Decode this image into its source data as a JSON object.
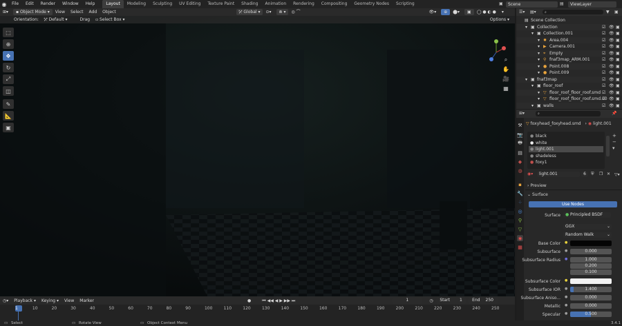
{
  "topbar": {
    "menus": [
      "File",
      "Edit",
      "Render",
      "Window",
      "Help"
    ],
    "workspaces": [
      "Layout",
      "Modeling",
      "Sculpting",
      "UV Editing",
      "Texture Paint",
      "Shading",
      "Animation",
      "Rendering",
      "Compositing",
      "Geometry Nodes",
      "Scripting"
    ],
    "active_workspace": "Layout",
    "scene": "Scene",
    "view_layer": "ViewLayer"
  },
  "viewport": {
    "mode": "Object Mode",
    "menus": [
      "View",
      "Select",
      "Add",
      "Object"
    ],
    "orientation_label": "Orientation:",
    "orientation_value": "Default",
    "drag_label": "Drag",
    "drag_value": "Select Box",
    "transform": "Global",
    "options": "Options"
  },
  "outliner": {
    "rows": [
      {
        "label": "Scene Collection",
        "indent": 0,
        "icon": "▤"
      },
      {
        "label": "Collection",
        "indent": 1,
        "icon": "▣"
      },
      {
        "label": "Collection.001",
        "indent": 2,
        "icon": "▣"
      },
      {
        "label": "Area.004",
        "indent": 3,
        "icon": "✹",
        "color": "#e8a33c"
      },
      {
        "label": "Camera.001",
        "indent": 3,
        "icon": "▶",
        "color": "#e8a33c"
      },
      {
        "label": "Empty",
        "indent": 3,
        "icon": "⌖",
        "color": "#e8a33c"
      },
      {
        "label": "fnaf3map_ARM.001",
        "indent": 3,
        "icon": "⚲",
        "color": "#e8a33c"
      },
      {
        "label": "Point.008",
        "indent": 3,
        "icon": "●",
        "color": "#e8a33c"
      },
      {
        "label": "Point.009",
        "indent": 3,
        "icon": "●",
        "color": "#e8a33c"
      },
      {
        "label": "fnaf3map",
        "indent": 1,
        "icon": "▣"
      },
      {
        "label": "floor_roof",
        "indent": 2,
        "icon": "▣"
      },
      {
        "label": "floor_roof_floor_roof.smd",
        "indent": 3,
        "icon": "▽",
        "color": "#e8a33c"
      },
      {
        "label": "floor_roof_floor_roof.smd.00",
        "indent": 3,
        "icon": "▽",
        "color": "#e8a33c"
      },
      {
        "label": "walls",
        "indent": 2,
        "icon": "▣"
      }
    ]
  },
  "properties": {
    "object_name": "foxyhead_foxyhead.smd",
    "material_name": "light.001",
    "slots": [
      "black",
      "white",
      "light.001",
      "shadeless",
      "foxy1"
    ],
    "selected_slot": "light.001",
    "material_field": "light.001",
    "user_count": "6",
    "preview_label": "Preview",
    "surface_panel": "Surface",
    "use_nodes": "Use Nodes",
    "surface_label": "Surface",
    "surface_value": "Principled BSDF",
    "distribution": "GGX",
    "subsurface_method": "Random Walk",
    "base_color_label": "Base Color",
    "base_color": "#050505",
    "subsurface_label": "Subsurface",
    "subsurface_value": "0.000",
    "subsurface_radius_label": "Subsurface Radius",
    "subsurface_radius": [
      "1.000",
      "0.200",
      "0.100"
    ],
    "subsurface_color_label": "Subsurface Color",
    "subsurface_color": "#f2f2f2",
    "subsurface_ior_label": "Subsurface IOR",
    "subsurface_ior": "1.400",
    "subsurface_aniso_label": "Subsurface Aniso...",
    "subsurface_aniso": "0.000",
    "metallic_label": "Metallic",
    "metallic": "0.000",
    "specular_label": "Specular",
    "specular": "0.500"
  },
  "timeline": {
    "menus": [
      "Playback",
      "Keying",
      "View",
      "Marker"
    ],
    "current_frame": "1",
    "start_label": "Start",
    "start": "1",
    "end_label": "End",
    "end": "250",
    "ticks": [
      "1",
      "10",
      "20",
      "30",
      "40",
      "50",
      "60",
      "70",
      "80",
      "90",
      "100",
      "110",
      "120",
      "130",
      "140",
      "150",
      "160",
      "170",
      "180",
      "190",
      "200",
      "210",
      "220",
      "230",
      "240",
      "250"
    ]
  },
  "status": {
    "select": "Select",
    "rotate": "Rotate View",
    "context": "Object Context Menu",
    "version": "3.4.1"
  },
  "colors": {
    "accent": "#4772b3",
    "selected_row": "#334d80"
  }
}
